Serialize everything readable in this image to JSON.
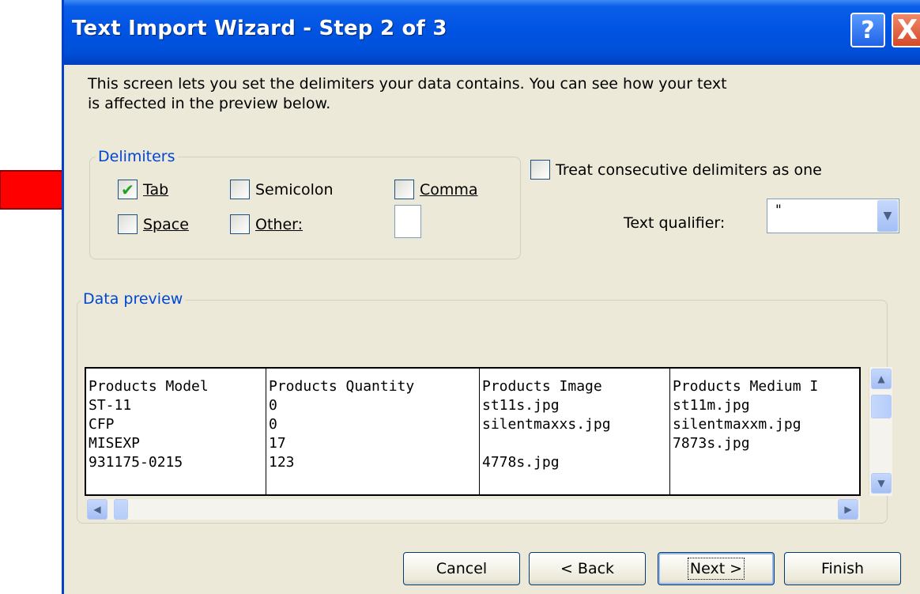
{
  "window": {
    "title": "Text Import Wizard - Step 2 of 3",
    "help_button": "?",
    "close_button": "X"
  },
  "intro_text": "This screen lets you set the delimiters your data contains.  You can see how your text is affected in the preview below.",
  "delimiters": {
    "group_label": "Delimiters",
    "tab": {
      "label": "Tab",
      "checked": true
    },
    "semicolon": {
      "label": "Semicolon",
      "checked": false
    },
    "comma": {
      "label": "Comma",
      "checked": false
    },
    "space": {
      "label": "Space",
      "checked": false
    },
    "other": {
      "label": "Other:",
      "checked": false,
      "value": ""
    }
  },
  "treat_consecutive": {
    "label": "Treat consecutive delimiters as one",
    "checked": false
  },
  "text_qualifier": {
    "label": "Text qualifier:",
    "value": "\""
  },
  "preview": {
    "group_label": "Data preview",
    "columns": [
      {
        "rows": [
          "Products Model",
          "ST-11",
          "CFP",
          "MISEXP",
          "931175-0215"
        ]
      },
      {
        "rows": [
          "Products Quantity",
          "0",
          "0",
          "17",
          "123"
        ]
      },
      {
        "rows": [
          "Products Image",
          "st11s.jpg",
          "silentmaxxs.jpg",
          "",
          "4778s.jpg"
        ]
      },
      {
        "rows": [
          "Products Medium I",
          "st11m.jpg",
          "silentmaxxm.jpg",
          "7873s.jpg",
          ""
        ]
      }
    ]
  },
  "buttons": {
    "cancel": "Cancel",
    "back": "< Back",
    "next": "Next >",
    "finish": "Finish"
  },
  "colors": {
    "arrow": "#ff0000",
    "titlebar": "#0054e3",
    "dialog_bg": "#ece9d8",
    "group_label": "#0046d5",
    "checkmark": "#21a121"
  }
}
